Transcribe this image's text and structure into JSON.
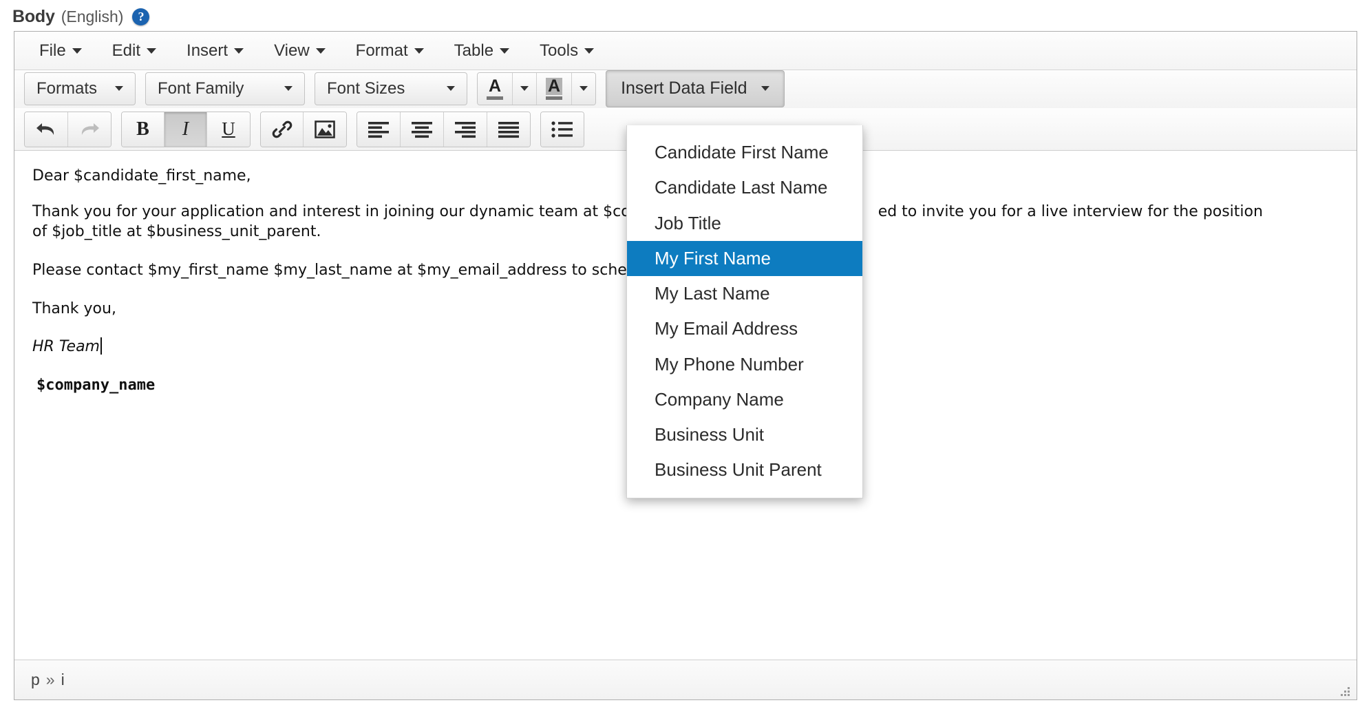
{
  "field": {
    "label": "Body",
    "language": "(English)",
    "help_icon": "?"
  },
  "menubar": {
    "items": [
      {
        "label": "File",
        "icon": "chevron-down-icon"
      },
      {
        "label": "Edit",
        "icon": "chevron-down-icon"
      },
      {
        "label": "Insert",
        "icon": "chevron-down-icon"
      },
      {
        "label": "View",
        "icon": "chevron-down-icon"
      },
      {
        "label": "Format",
        "icon": "chevron-down-icon"
      },
      {
        "label": "Table",
        "icon": "chevron-down-icon"
      },
      {
        "label": "Tools",
        "icon": "chevron-down-icon"
      }
    ]
  },
  "toolbar_row1": {
    "formats": "Formats",
    "font_family": "Font Family",
    "font_sizes": "Font Sizes",
    "text_color_glyph": "A",
    "background_color_glyph": "A",
    "insert_data_field": "Insert Data Field"
  },
  "toolbar_row2": {
    "undo": "undo-icon",
    "redo": "redo-icon",
    "bold": "B",
    "italic": "I",
    "underline": "U",
    "link": "link-icon",
    "image": "image-icon",
    "align_left": "align-left-icon",
    "align_center": "align-center-icon",
    "align_right": "align-right-icon",
    "align_justify": "align-justify-icon",
    "bullet_list": "bullet-list-icon"
  },
  "body_content": {
    "greeting": "Dear $candidate_first_name,",
    "paragraph_1_part_a": "Thank you for your application and interest in joining our dynamic team at  $co",
    "paragraph_1_part_b": "ed to invite you for a live interview for the position",
    "paragraph_1_line2": "of $job_title at $business_unit_parent.",
    "paragraph_2": "Please contact $my_first_name $my_last_name at $my_email_address to sche",
    "closing": "Thank you,",
    "signature": "HR Team",
    "company_token": "$company_name"
  },
  "dropdown": {
    "items": [
      "Candidate First Name",
      "Candidate Last Name",
      "Job Title",
      "My First Name",
      "My Last Name",
      "My Email Address",
      "My Phone Number",
      "Company Name",
      "Business Unit",
      "Business Unit Parent"
    ],
    "selected_index": 3,
    "highlight_color": "#0d7cc0"
  },
  "statusbar": {
    "path_root": "p",
    "path_sep": "»",
    "path_leaf": "i"
  }
}
